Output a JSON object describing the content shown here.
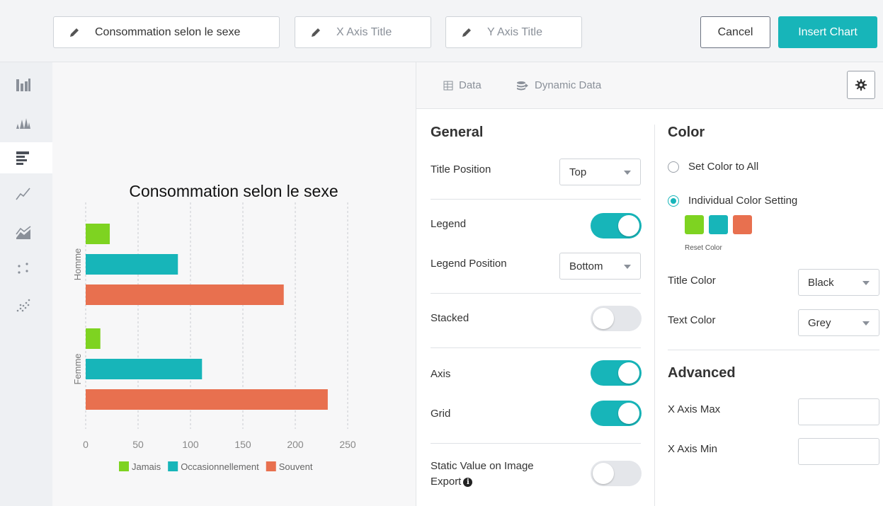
{
  "header": {
    "chart_title_value": "Consommation selon le sexe",
    "x_axis_placeholder": "X Axis Title",
    "y_axis_placeholder": "Y Axis Title",
    "cancel_label": "Cancel",
    "insert_label": "Insert Chart"
  },
  "rail": {
    "icons": [
      "column-chart-icon",
      "histogram-icon",
      "bar-chart-icon",
      "line-chart-icon",
      "area-chart-icon",
      "scatter-icon",
      "bubble-scatter-icon"
    ],
    "active": "bar-chart-icon"
  },
  "tabs": {
    "data_label": "Data",
    "dynamic_label": "Dynamic Data"
  },
  "general": {
    "heading": "General",
    "title_position_label": "Title Position",
    "title_position_value": "Top",
    "legend_label": "Legend",
    "legend_on": true,
    "legend_position_label": "Legend Position",
    "legend_position_value": "Bottom",
    "stacked_label": "Stacked",
    "stacked_on": false,
    "axis_label": "Axis",
    "axis_on": true,
    "grid_label": "Grid",
    "grid_on": true,
    "static_value_label_line1": "Static Value on Image",
    "static_value_label_line2": "Export",
    "static_value_on": false
  },
  "color": {
    "heading": "Color",
    "set_all_label": "Set Color to All",
    "individual_label": "Individual Color Setting",
    "individual_selected": true,
    "swatches": [
      "#7ed321",
      "#17b5b9",
      "#e8704f"
    ],
    "reset_label": "Reset Color",
    "title_color_label": "Title Color",
    "title_color_value": "Black",
    "text_color_label": "Text Color",
    "text_color_value": "Grey"
  },
  "advanced": {
    "heading": "Advanced",
    "x_max_label": "X Axis Max",
    "x_min_label": "X Axis Min"
  },
  "chart_data": {
    "type": "bar",
    "orientation": "horizontal",
    "title": "Consommation selon le sexe",
    "categories": [
      "Homme",
      "Femme"
    ],
    "series": [
      {
        "name": "Jamais",
        "color": "#7ed321",
        "values": [
          23,
          14
        ]
      },
      {
        "name": "Occasionnellement",
        "color": "#17b5b9",
        "values": [
          88,
          111
        ]
      },
      {
        "name": "Souvent",
        "color": "#e8704f",
        "values": [
          189,
          231
        ]
      }
    ],
    "xlim": [
      0,
      250
    ],
    "xticks": [
      "0",
      "50",
      "100",
      "150",
      "200",
      "250"
    ],
    "grid": true,
    "legend_position": "bottom"
  }
}
